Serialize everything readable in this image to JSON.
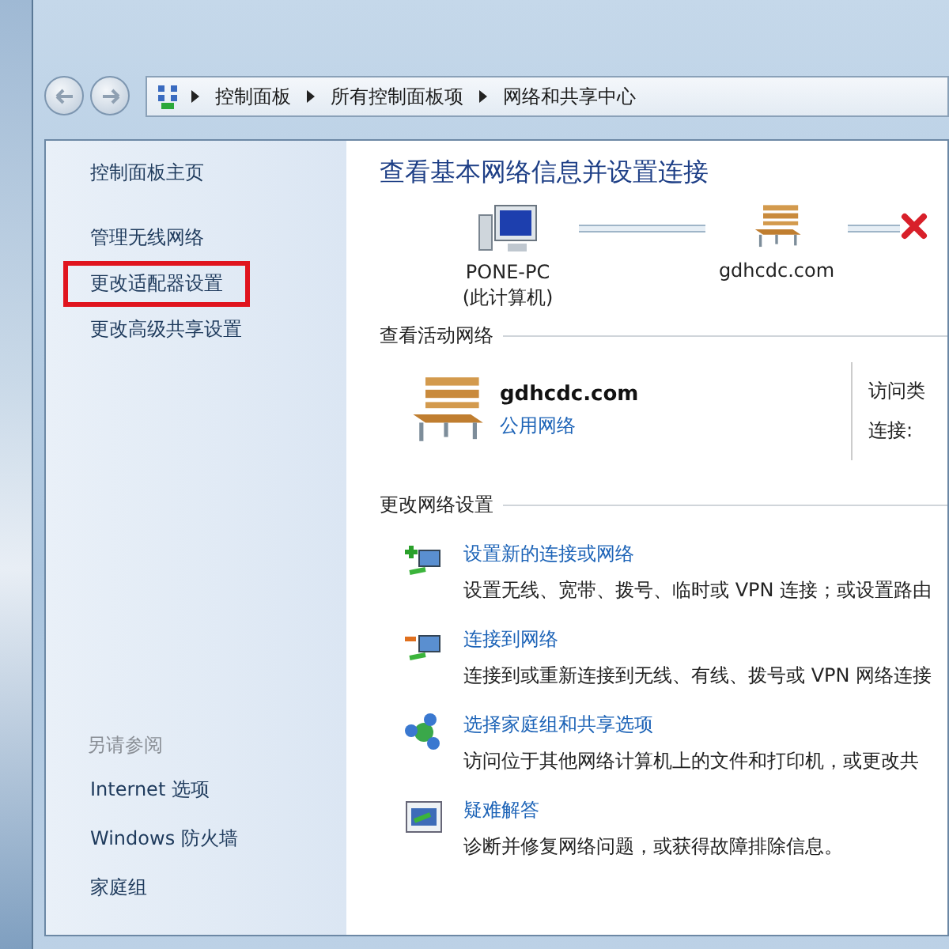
{
  "address_bar": {
    "crumbs": [
      "控制面板",
      "所有控制面板项",
      "网络和共享中心"
    ]
  },
  "sidebar": {
    "home": "控制面板主页",
    "tasks": [
      {
        "label": "管理无线网络",
        "highlighted": false
      },
      {
        "label": "更改适配器设置",
        "highlighted": true
      },
      {
        "label": "更改高级共享设置",
        "highlighted": false
      }
    ],
    "see_also": {
      "heading": "另请参阅",
      "links": [
        "Internet 选项",
        "Windows 防火墙",
        "家庭组"
      ]
    }
  },
  "main": {
    "title": "查看基本网络信息并设置连接",
    "network_map": [
      {
        "kind": "computer",
        "name": "PONE-PC",
        "note": "(此计算机)"
      },
      {
        "kind": "network",
        "name": "gdhcdc.com"
      },
      {
        "kind": "disconnected"
      }
    ],
    "active_networks": {
      "heading": "查看活动网络",
      "network": {
        "name": "gdhcdc.com",
        "type": "公用网络"
      },
      "details": [
        "访问类",
        "连接:"
      ]
    },
    "change_settings": {
      "heading": "更改网络设置",
      "tasks": [
        {
          "kind": "new-connection",
          "title": "设置新的连接或网络",
          "description": "设置无线、宽带、拨号、临时或 VPN 连接；或设置路由"
        },
        {
          "kind": "connect",
          "title": "连接到网络",
          "description": "连接到或重新连接到无线、有线、拨号或 VPN 网络连接"
        },
        {
          "kind": "homegroup",
          "title": "选择家庭组和共享选项",
          "description": "访问位于其他网络计算机上的文件和打印机，或更改共"
        },
        {
          "kind": "troubleshoot",
          "title": "疑难解答",
          "description": "诊断并修复网络问题，或获得故障排除信息。"
        }
      ]
    }
  }
}
